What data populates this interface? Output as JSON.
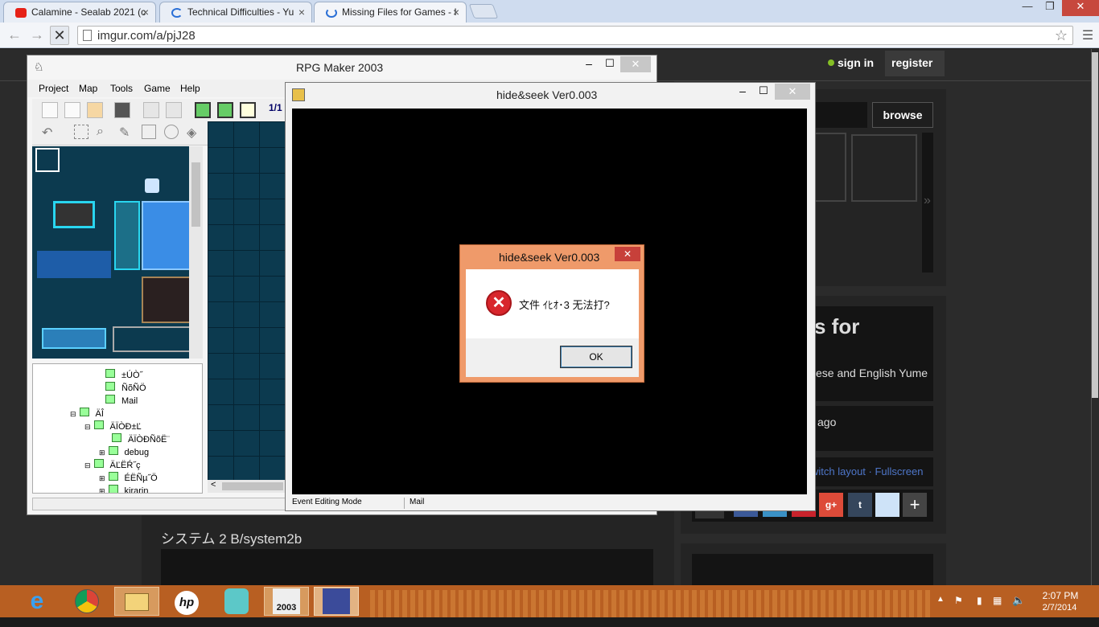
{
  "browser": {
    "tabs": [
      {
        "title": "Calamine - Sealab 2021 (c",
        "fav_color": "#e62117"
      },
      {
        "title": "Technical Difficulties - Yu",
        "fav_color": "#2a6fd6"
      },
      {
        "title": "Missing Files for Games - I",
        "fav_color": "#2a6fd6"
      }
    ],
    "url": "imgur.com/a/pjJ28",
    "window_controls": {
      "minimize": "—",
      "maximize": "❐",
      "close": "✕"
    }
  },
  "imgur": {
    "sign_in": "sign in",
    "register": "register",
    "browse": "browse",
    "title_partial": "s for",
    "desc_partial": "ese and English Yume",
    "time_partial": "ago",
    "links": "witch layout · Fullscreen",
    "caption": "システム 2 B/system2b",
    "arrow": "»"
  },
  "rpgmaker": {
    "title": "RPG Maker 2003",
    "menu": [
      "Project",
      "Map",
      "Tools",
      "Game",
      "Help"
    ],
    "tree_items": [
      {
        "label": "±ÚÒ˝",
        "level": 3
      },
      {
        "label": "ÑõÑÖ",
        "level": 3
      },
      {
        "label": "Mail",
        "level": 3
      },
      {
        "label": "ÄÎ",
        "level": 1
      },
      {
        "label": "ÄÏÒÐ±Ľ",
        "level": 2
      },
      {
        "label": "ÄÏÒÐÑõË¨",
        "level": 3
      },
      {
        "label": "debug",
        "level": 3
      },
      {
        "label": "ÄĽËŔ˝ç",
        "level": 2
      },
      {
        "label": "ÉËÑµ˝Ö",
        "level": 3
      },
      {
        "label": "kirarin",
        "level": 3
      }
    ],
    "status_left": "Event Editing Mode",
    "status_right": "Mail"
  },
  "game_window": {
    "title": "hide&seek Ver0.003"
  },
  "error_dialog": {
    "title": "hide&seek Ver0.003",
    "message": "文件 ｲﾋｵ･3 无法打?",
    "ok": "OK",
    "close": "✕"
  },
  "taskbar": {
    "time": "2:07 PM",
    "date": "2/7/2014",
    "apps": [
      "internet-explorer-icon",
      "chrome-icon",
      "file-explorer-icon",
      "hp-icon",
      "miku-icon",
      "rpgmaker-2003-icon",
      "game-icon"
    ],
    "rm_label": "2003"
  }
}
